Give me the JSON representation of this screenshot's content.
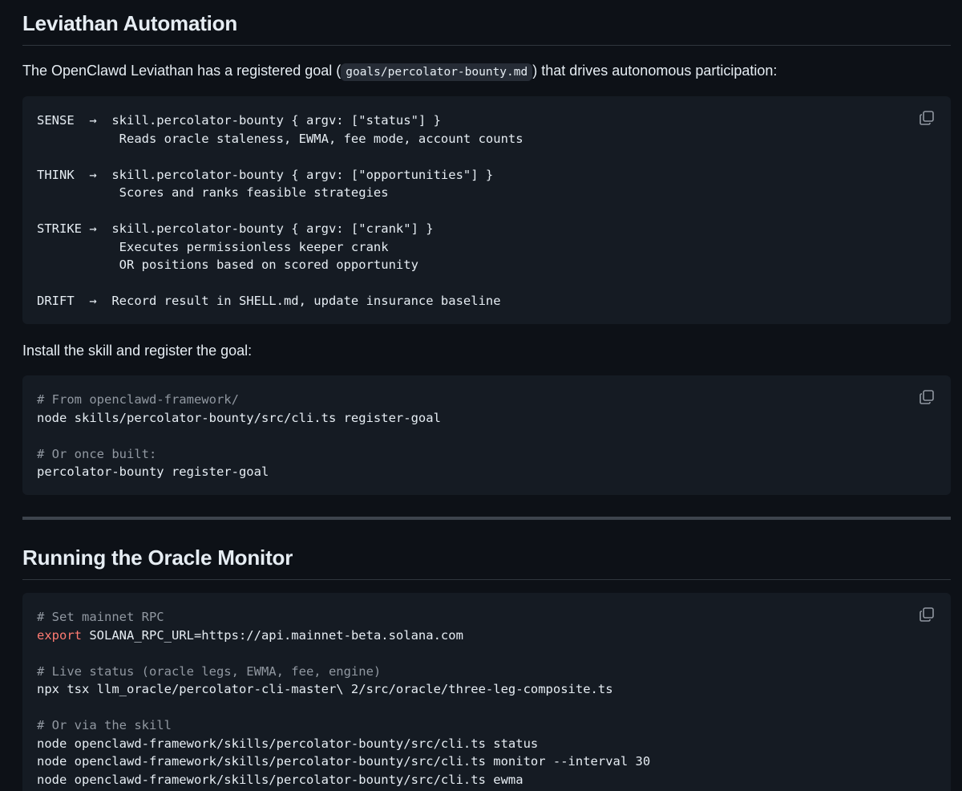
{
  "sections": {
    "leviathan": {
      "heading": "Leviathan Automation",
      "intro_before": "The OpenClawd Leviathan has a registered goal (",
      "intro_code": "goals/percolator-bounty.md",
      "intro_after": ") that drives autonomous participation:",
      "loop_code": [
        "SENSE  →  skill.percolator-bounty { argv: [\"status\"] }",
        "           Reads oracle staleness, EWMA, fee mode, account counts",
        "",
        "THINK  →  skill.percolator-bounty { argv: [\"opportunities\"] }",
        "           Scores and ranks feasible strategies",
        "",
        "STRIKE →  skill.percolator-bounty { argv: [\"crank\"] }",
        "           Executes permissionless keeper crank",
        "           OR positions based on scored opportunity",
        "",
        "DRIFT  →  Record result in SHELL.md, update insurance baseline"
      ],
      "install_text": "Install the skill and register the goal:",
      "install_code": {
        "comment1": "# From openclawd-framework/",
        "line1": "node skills/percolator-bounty/src/cli.ts register-goal",
        "comment2": "# Or once built:",
        "line2": "percolator-bounty register-goal"
      }
    },
    "oracle_monitor": {
      "heading": "Running the Oracle Monitor",
      "code": {
        "comment1": "# Set mainnet RPC",
        "export_keyword": "export",
        "export_rest": " SOLANA_RPC_URL=https://api.mainnet-beta.solana.com",
        "comment2": "# Live status (oracle legs, EWMA, fee, engine)",
        "line2": "npx tsx llm_oracle/percolator-cli-master\\ 2/src/oracle/three-leg-composite.ts",
        "comment3": "# Or via the skill",
        "line3a": "node openclawd-framework/skills/percolator-bounty/src/cli.ts status",
        "line3b": "node openclawd-framework/skills/percolator-bounty/src/cli.ts monitor --interval 30",
        "line3c": "node openclawd-framework/skills/percolator-bounty/src/cli.ts ewma"
      }
    }
  },
  "icons": {
    "copy": "copy-icon"
  }
}
